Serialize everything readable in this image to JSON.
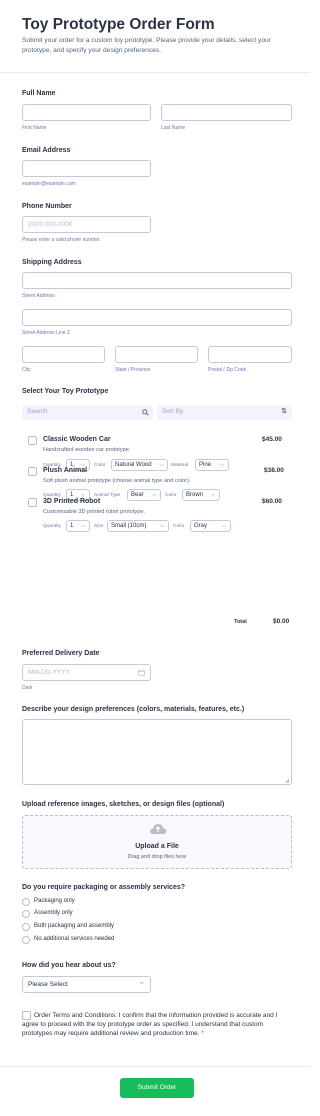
{
  "header": {
    "title": "Toy Prototype Order Form",
    "subtitle": "Submit your order for a custom toy prototype. Please provide your details, select your prototype, and specify your design preferences."
  },
  "full_name": {
    "label": "Full Name",
    "first_sub": "First Name",
    "last_sub": "Last Name"
  },
  "email": {
    "label": "Email Address",
    "sub": "example@example.com"
  },
  "phone": {
    "label": "Phone Number",
    "placeholder": "(000) 000-0000",
    "sub": "Please enter a valid phone number."
  },
  "shipping": {
    "label": "Shipping Address",
    "street_sub": "Street Address",
    "street2_sub": "Street Address Line 2",
    "city_sub": "City",
    "state_sub": "State / Province",
    "zip_sub": "Postal / Zip Code"
  },
  "products": {
    "label": "Select Your Toy Prototype",
    "search_placeholder": "Search",
    "sort_placeholder": "Sort By",
    "items": [
      {
        "name": "Classic Wooden Car",
        "description": "Handcrafted wooden car prototype.",
        "price": "$45.00",
        "options": [
          {
            "label": "Quantity",
            "value": "1"
          },
          {
            "label": "Color",
            "value": "Natural Wood"
          },
          {
            "label": "Material",
            "value": "Pine"
          }
        ]
      },
      {
        "name": "Plush Animal",
        "description": "Soft plush animal prototype (choose animal type and color).",
        "price": "$38.00",
        "options": [
          {
            "label": "Quantity",
            "value": "1"
          },
          {
            "label": "Animal Type",
            "value": "Bear"
          },
          {
            "label": "Color",
            "value": "Brown"
          }
        ]
      },
      {
        "name": "3D Printed Robot",
        "description": "Customizable 3D printed robot prototype.",
        "price": "$60.00",
        "options": [
          {
            "label": "Quantity",
            "value": "1"
          },
          {
            "label": "Size",
            "value": "Small (10cm)"
          },
          {
            "label": "Color",
            "value": "Gray"
          }
        ]
      }
    ],
    "total_label": "Total",
    "total_value": "$0.00"
  },
  "delivery": {
    "label": "Preferred Delivery Date",
    "placeholder": "MM-DD-YYYY",
    "sub": "Date"
  },
  "design": {
    "label": "Describe your design preferences (colors, materials, features, etc.)"
  },
  "upload": {
    "label": "Upload reference images, sketches, or design files (optional)",
    "title": "Upload a File",
    "hint": "Drag and drop files here"
  },
  "services": {
    "label": "Do you require packaging or assembly services?",
    "options": [
      "Packaging only",
      "Assembly only",
      "Both packaging and assembly",
      "No additional services needed"
    ]
  },
  "referral": {
    "label": "How did you hear about us?",
    "value": "Please Select"
  },
  "terms": {
    "text": "Order Terms and Conditions: I confirm that the information provided is accurate and I agree to proceed with the toy prototype order as specified. I understand that custom prototypes may require additional review and production time.",
    "required_mark": "*"
  },
  "submit_label": "Submit Order",
  "colors": {
    "accent": "#18bd5b",
    "required": "#f23a3c",
    "text": "#2c3345"
  }
}
